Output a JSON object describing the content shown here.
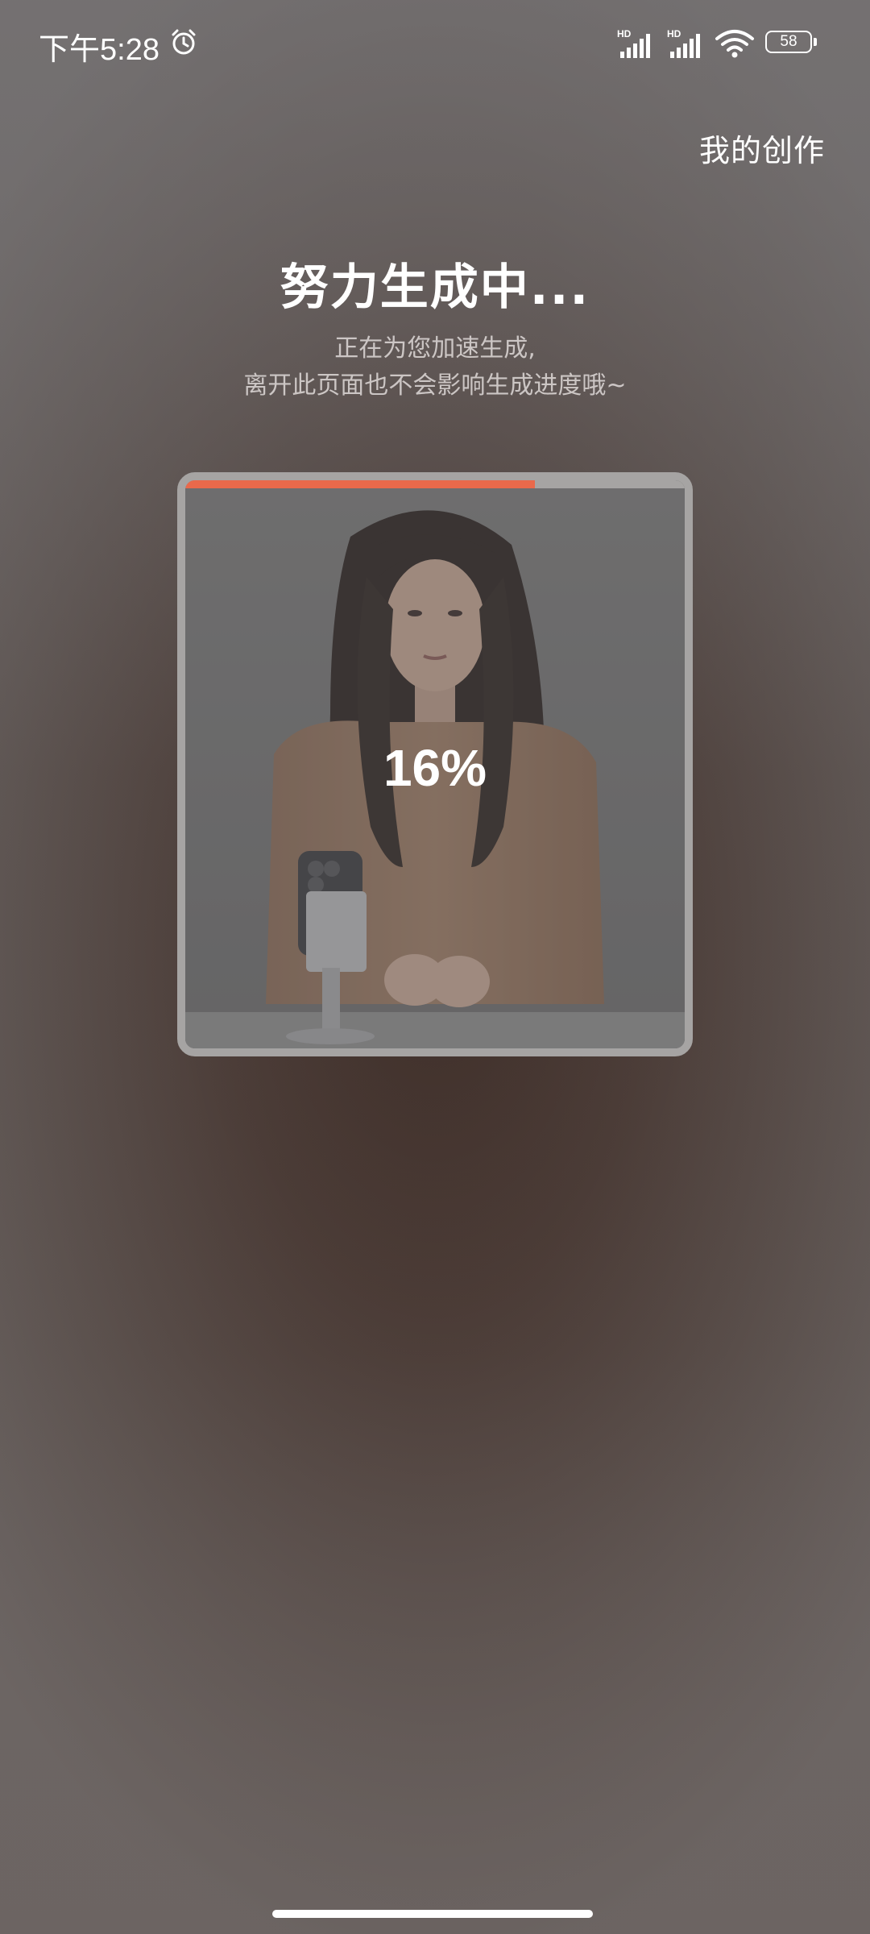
{
  "status_bar": {
    "time": "下午5:28",
    "battery": "58",
    "signal_labels": [
      "HD",
      "HD"
    ]
  },
  "header": {
    "my_creations": "我的创作"
  },
  "main": {
    "title": "努力生成中...",
    "subtitle_line1": "正在为您加速生成,",
    "subtitle_line2": "离开此页面也不会影响生成进度哦~"
  },
  "preview": {
    "progress_percent": 16,
    "progress_label": "16%",
    "progress_bar_fraction": 0.7
  },
  "colors": {
    "accent": "#e9694b",
    "card_border": "#a6a4a3"
  },
  "icons": [
    "alarm-icon",
    "signal-icon",
    "wifi-icon",
    "battery-icon"
  ]
}
